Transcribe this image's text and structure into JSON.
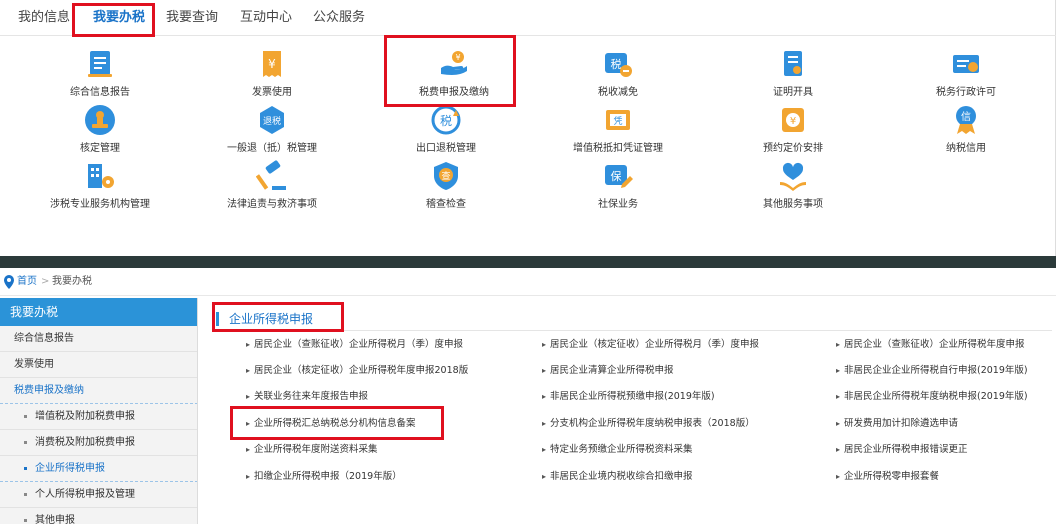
{
  "tabs": [
    "我的信息",
    "我要办税",
    "我要查询",
    "互动中心",
    "公众服务"
  ],
  "services": [
    {
      "label": "综合信息报告",
      "icon": "report-icon"
    },
    {
      "label": "发票使用",
      "icon": "invoice-icon"
    },
    {
      "label": "税费申报及缴纳",
      "icon": "hand-coin-icon"
    },
    {
      "label": "税收减免",
      "icon": "tax-relief-icon"
    },
    {
      "label": "证明开具",
      "icon": "certificate-icon"
    },
    {
      "label": "税务行政许可",
      "icon": "license-icon"
    },
    {
      "label": "核定管理",
      "icon": "stamp-icon"
    },
    {
      "label": "一般退（抵）税管理",
      "icon": "refund-icon"
    },
    {
      "label": "出口退税管理",
      "icon": "export-refund-icon"
    },
    {
      "label": "增值税抵扣凭证管理",
      "icon": "voucher-icon"
    },
    {
      "label": "预约定价安排",
      "icon": "pricing-icon"
    },
    {
      "label": "纳税信用",
      "icon": "credit-medal-icon"
    },
    {
      "label": "涉税专业服务机构管理",
      "icon": "agency-building-icon"
    },
    {
      "label": "法律追责与救济事项",
      "icon": "gavel-icon"
    },
    {
      "label": "稽查检查",
      "icon": "inspection-shield-icon"
    },
    {
      "label": "社保业务",
      "icon": "social-security-icon"
    },
    {
      "label": "其他服务事项",
      "icon": "heart-hands-icon"
    }
  ],
  "breadcrumb": {
    "home": "首页",
    "sep": ">",
    "current": "我要办税"
  },
  "sidebar": {
    "title": "我要办税",
    "items": [
      {
        "label": "综合信息报告",
        "level": 1,
        "active": false
      },
      {
        "label": "发票使用",
        "level": 1,
        "active": false
      },
      {
        "label": "税费申报及缴纳",
        "level": 1,
        "active": true
      },
      {
        "label": "增值税及附加税费申报",
        "level": 2,
        "active": false
      },
      {
        "label": "消费税及附加税费申报",
        "level": 2,
        "active": false
      },
      {
        "label": "企业所得税申报",
        "level": 2,
        "active": true
      },
      {
        "label": "个人所得税申报及管理",
        "level": 2,
        "active": false
      },
      {
        "label": "其他申报",
        "level": 2,
        "active": false
      }
    ]
  },
  "section": {
    "title": "企业所得税申报",
    "links": [
      "居民企业（查账征收）企业所得税月（季）度申报",
      "居民企业（核定征收）企业所得税月（季）度申报",
      "居民企业（查账征收）企业所得税年度申报",
      "居民企业（核定征收）企业所得税年度申报2018版",
      "居民企业清算企业所得税申报",
      "非居民企业企业所得税自行申报(2019年版)",
      "关联业务往来年度报告申报",
      "非居民企业所得税预缴申报(2019年版)",
      "非居民企业所得税年度纳税申报(2019年版)",
      "企业所得税汇总纳税总分机构信息备案",
      "分支机构企业所得税年度纳税申报表（2018版）",
      "研发费用加计扣除遴选申请",
      "企业所得税年度附送资料采集",
      "特定业务预缴企业所得税资料采集",
      "居民企业所得税申报错误更正",
      "扣缴企业所得税申报（2019年版）",
      "非居民企业境内税收综合扣缴申报",
      "企业所得税零申报套餐"
    ]
  },
  "colors": {
    "accent": "#1a73c8",
    "highlight": "#e0101f",
    "sidebar_head": "#2b93d8"
  }
}
